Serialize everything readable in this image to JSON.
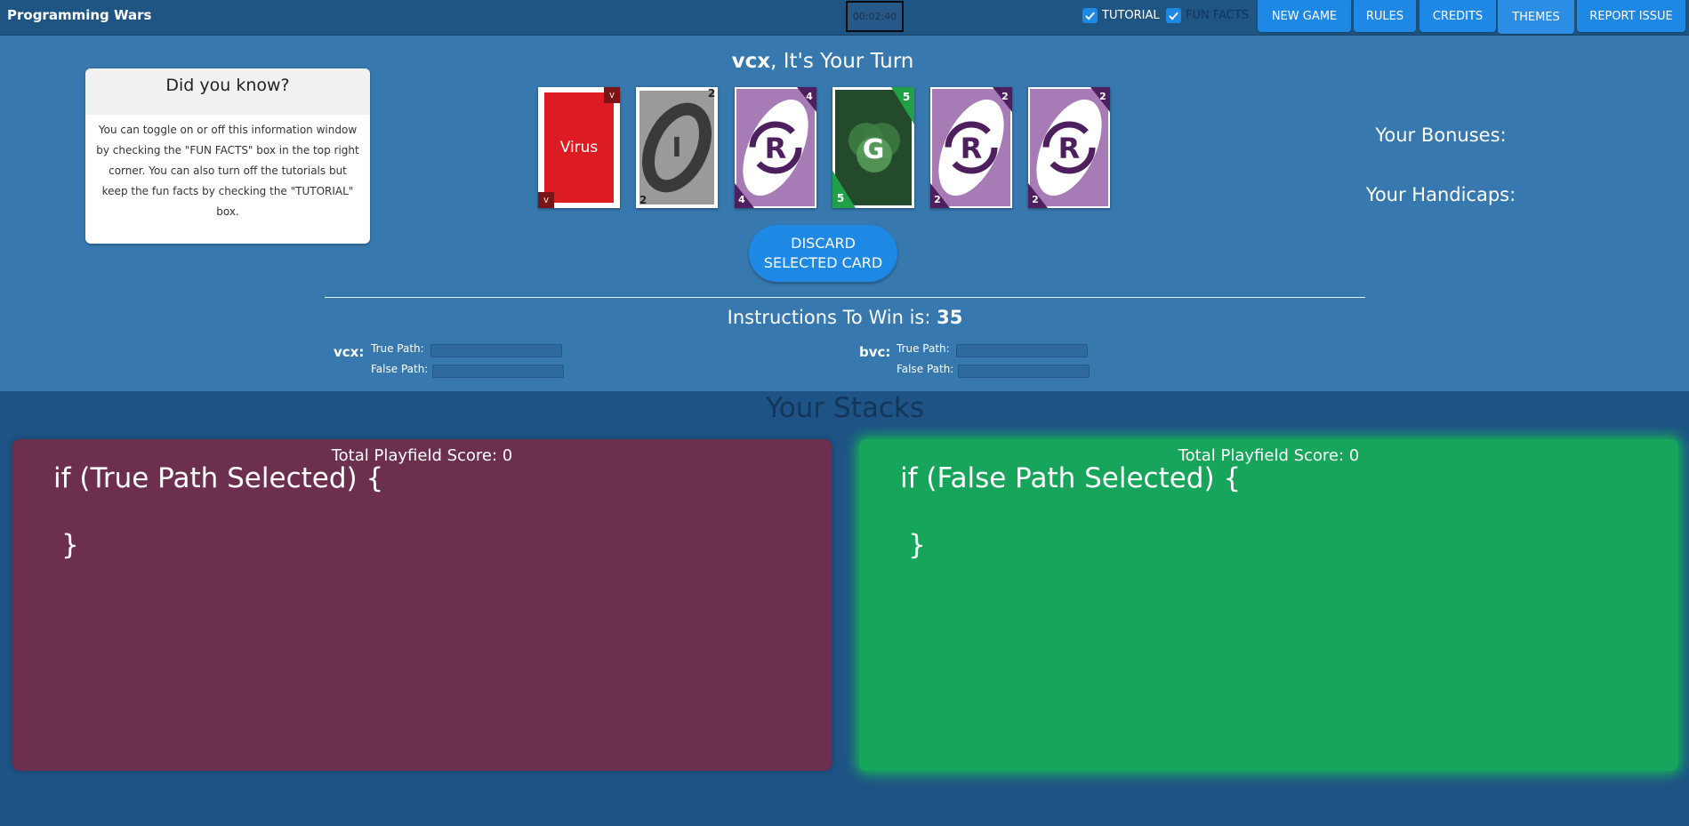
{
  "app": {
    "title": "Programming Wars",
    "timer": "00:02:40"
  },
  "nav": {
    "tutorial_label": "TUTORIAL",
    "tutorial_checked": true,
    "funfacts_label": "FUN FACTS",
    "funfacts_checked": true,
    "buttons": {
      "new_game": "NEW GAME",
      "rules": "RULES",
      "credits": "CREDITS",
      "themes": "THEMES",
      "report": "REPORT ISSUE"
    }
  },
  "fun_facts": {
    "title": "Did you know?",
    "body": "You can toggle on or off this information window by checking the \"FUN FACTS\" box in the top right corner. You can also turn off the tutorials but keep the fun facts by checking the \"TUTORIAL\" box."
  },
  "turn": {
    "player": "vcx",
    "suffix": ", It's Your Turn"
  },
  "hand": [
    {
      "type": "virus",
      "label": "Virus",
      "corner": "V",
      "color": "#dc1c22"
    },
    {
      "type": "instruction",
      "letter": "I",
      "value": "2",
      "color": "#9a9a9a"
    },
    {
      "type": "repeat",
      "letter": "R",
      "value": "4",
      "color": "#a77bb5"
    },
    {
      "type": "group",
      "letter": "G",
      "value": "5",
      "color": "#234a2b"
    },
    {
      "type": "repeat",
      "letter": "R",
      "value": "2",
      "color": "#a77bb5"
    },
    {
      "type": "repeat",
      "letter": "R",
      "value": "2",
      "color": "#a77bb5"
    }
  ],
  "discard_button": {
    "line1": "DISCARD",
    "line2": "SELECTED CARD"
  },
  "bonuses_label": "Your Bonuses:",
  "handicaps_label": "Your Handicaps:",
  "win": {
    "label": "Instructions To Win is: ",
    "value": "35"
  },
  "players": [
    {
      "name": "vcx:",
      "true_label": "True Path:",
      "false_label": "False Path:",
      "true_progress": 0,
      "false_progress": 0
    },
    {
      "name": "bvc:",
      "true_label": "True Path:",
      "false_label": "False Path:",
      "true_progress": 0,
      "false_progress": 0
    }
  ],
  "stacks": {
    "title": "Your Stacks",
    "true": {
      "score": "Total Playfield Score: 0",
      "open": "if (True Path Selected) {",
      "close": "}",
      "color": "#6c2f4d"
    },
    "false": {
      "score": "Total Playfield Score: 0",
      "open": "if (False Path Selected) {",
      "close": "}",
      "color": "#16a55a",
      "selected": true
    }
  }
}
